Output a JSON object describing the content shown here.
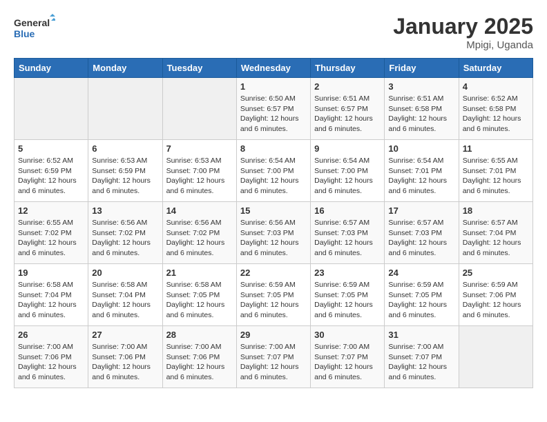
{
  "logo": {
    "line1": "General",
    "line2": "Blue"
  },
  "calendar": {
    "title": "January 2025",
    "subtitle": "Mpigi, Uganda"
  },
  "weekdays": [
    "Sunday",
    "Monday",
    "Tuesday",
    "Wednesday",
    "Thursday",
    "Friday",
    "Saturday"
  ],
  "weeks": [
    [
      {
        "day": "",
        "info": ""
      },
      {
        "day": "",
        "info": ""
      },
      {
        "day": "",
        "info": ""
      },
      {
        "day": "1",
        "info": "Sunrise: 6:50 AM\nSunset: 6:57 PM\nDaylight: 12 hours\nand 6 minutes."
      },
      {
        "day": "2",
        "info": "Sunrise: 6:51 AM\nSunset: 6:57 PM\nDaylight: 12 hours\nand 6 minutes."
      },
      {
        "day": "3",
        "info": "Sunrise: 6:51 AM\nSunset: 6:58 PM\nDaylight: 12 hours\nand 6 minutes."
      },
      {
        "day": "4",
        "info": "Sunrise: 6:52 AM\nSunset: 6:58 PM\nDaylight: 12 hours\nand 6 minutes."
      }
    ],
    [
      {
        "day": "5",
        "info": "Sunrise: 6:52 AM\nSunset: 6:59 PM\nDaylight: 12 hours\nand 6 minutes."
      },
      {
        "day": "6",
        "info": "Sunrise: 6:53 AM\nSunset: 6:59 PM\nDaylight: 12 hours\nand 6 minutes."
      },
      {
        "day": "7",
        "info": "Sunrise: 6:53 AM\nSunset: 7:00 PM\nDaylight: 12 hours\nand 6 minutes."
      },
      {
        "day": "8",
        "info": "Sunrise: 6:54 AM\nSunset: 7:00 PM\nDaylight: 12 hours\nand 6 minutes."
      },
      {
        "day": "9",
        "info": "Sunrise: 6:54 AM\nSunset: 7:00 PM\nDaylight: 12 hours\nand 6 minutes."
      },
      {
        "day": "10",
        "info": "Sunrise: 6:54 AM\nSunset: 7:01 PM\nDaylight: 12 hours\nand 6 minutes."
      },
      {
        "day": "11",
        "info": "Sunrise: 6:55 AM\nSunset: 7:01 PM\nDaylight: 12 hours\nand 6 minutes."
      }
    ],
    [
      {
        "day": "12",
        "info": "Sunrise: 6:55 AM\nSunset: 7:02 PM\nDaylight: 12 hours\nand 6 minutes."
      },
      {
        "day": "13",
        "info": "Sunrise: 6:56 AM\nSunset: 7:02 PM\nDaylight: 12 hours\nand 6 minutes."
      },
      {
        "day": "14",
        "info": "Sunrise: 6:56 AM\nSunset: 7:02 PM\nDaylight: 12 hours\nand 6 minutes."
      },
      {
        "day": "15",
        "info": "Sunrise: 6:56 AM\nSunset: 7:03 PM\nDaylight: 12 hours\nand 6 minutes."
      },
      {
        "day": "16",
        "info": "Sunrise: 6:57 AM\nSunset: 7:03 PM\nDaylight: 12 hours\nand 6 minutes."
      },
      {
        "day": "17",
        "info": "Sunrise: 6:57 AM\nSunset: 7:03 PM\nDaylight: 12 hours\nand 6 minutes."
      },
      {
        "day": "18",
        "info": "Sunrise: 6:57 AM\nSunset: 7:04 PM\nDaylight: 12 hours\nand 6 minutes."
      }
    ],
    [
      {
        "day": "19",
        "info": "Sunrise: 6:58 AM\nSunset: 7:04 PM\nDaylight: 12 hours\nand 6 minutes."
      },
      {
        "day": "20",
        "info": "Sunrise: 6:58 AM\nSunset: 7:04 PM\nDaylight: 12 hours\nand 6 minutes."
      },
      {
        "day": "21",
        "info": "Sunrise: 6:58 AM\nSunset: 7:05 PM\nDaylight: 12 hours\nand 6 minutes."
      },
      {
        "day": "22",
        "info": "Sunrise: 6:59 AM\nSunset: 7:05 PM\nDaylight: 12 hours\nand 6 minutes."
      },
      {
        "day": "23",
        "info": "Sunrise: 6:59 AM\nSunset: 7:05 PM\nDaylight: 12 hours\nand 6 minutes."
      },
      {
        "day": "24",
        "info": "Sunrise: 6:59 AM\nSunset: 7:05 PM\nDaylight: 12 hours\nand 6 minutes."
      },
      {
        "day": "25",
        "info": "Sunrise: 6:59 AM\nSunset: 7:06 PM\nDaylight: 12 hours\nand 6 minutes."
      }
    ],
    [
      {
        "day": "26",
        "info": "Sunrise: 7:00 AM\nSunset: 7:06 PM\nDaylight: 12 hours\nand 6 minutes."
      },
      {
        "day": "27",
        "info": "Sunrise: 7:00 AM\nSunset: 7:06 PM\nDaylight: 12 hours\nand 6 minutes."
      },
      {
        "day": "28",
        "info": "Sunrise: 7:00 AM\nSunset: 7:06 PM\nDaylight: 12 hours\nand 6 minutes."
      },
      {
        "day": "29",
        "info": "Sunrise: 7:00 AM\nSunset: 7:07 PM\nDaylight: 12 hours\nand 6 minutes."
      },
      {
        "day": "30",
        "info": "Sunrise: 7:00 AM\nSunset: 7:07 PM\nDaylight: 12 hours\nand 6 minutes."
      },
      {
        "day": "31",
        "info": "Sunrise: 7:00 AM\nSunset: 7:07 PM\nDaylight: 12 hours\nand 6 minutes."
      },
      {
        "day": "",
        "info": ""
      }
    ]
  ]
}
